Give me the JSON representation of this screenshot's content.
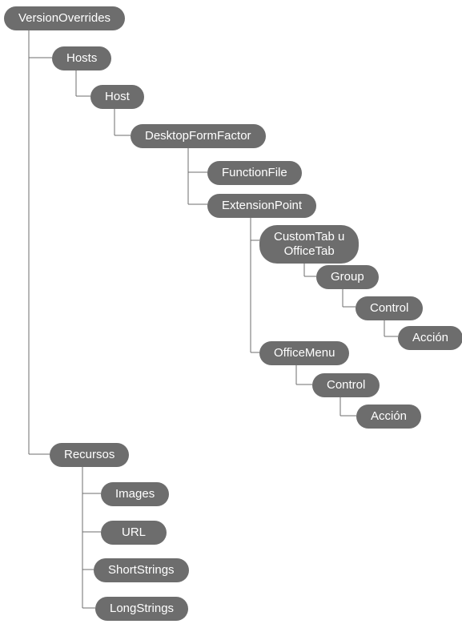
{
  "tree": {
    "versionOverrides": "VersionOverrides",
    "hosts": "Hosts",
    "host": "Host",
    "desktopFormFactor": "DesktopFormFactor",
    "functionFile": "FunctionFile",
    "extensionPoint": "ExtensionPoint",
    "customTab": "CustomTab u\nOfficeTab",
    "group": "Group",
    "control1": "Control",
    "accion1": "Acción",
    "officeMenu": "OfficeMenu",
    "control2": "Control",
    "accion2": "Acción",
    "recursos": "Recursos",
    "images": "Images",
    "url": "URL",
    "shortStrings": "ShortStrings",
    "longStrings": "LongStrings"
  }
}
